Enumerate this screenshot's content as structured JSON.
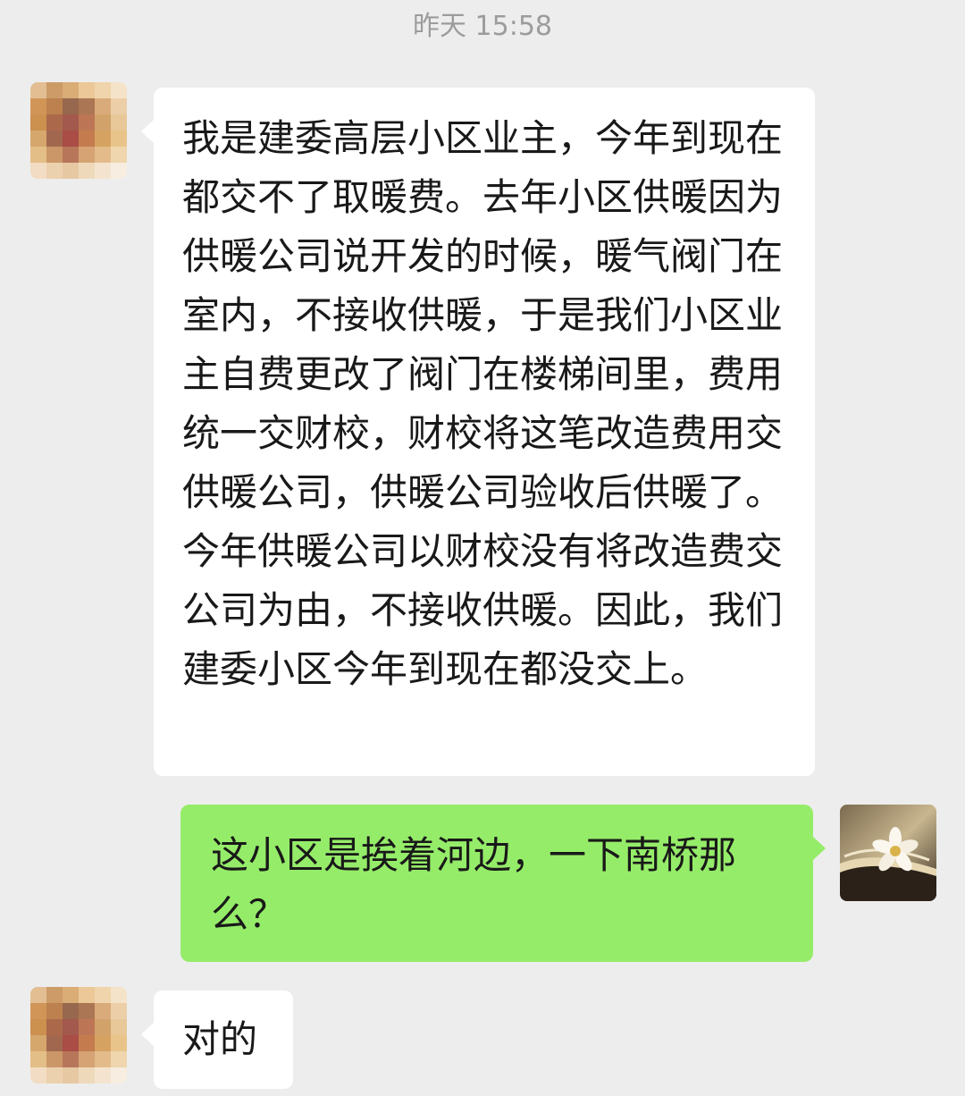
{
  "chat": {
    "timestamp": "昨天 15:58",
    "messages": [
      {
        "side": "left",
        "sender": "other",
        "text": "我是建委高层小区业主，今年到现在都交不了取暖费。去年小区供暖因为供暖公司说开发的时候，暖气阀门在室内，不接收供暖，于是我们小区业主自费更改了阀门在楼梯间里，费用统一交财校，财校将这笔改造费用交供暖公司，供暖公司验收后供暖了。今年供暖公司以财校没有将改造费交公司为由，不接收供暖。因此，我们建委小区今年到现在都没交上。"
      },
      {
        "side": "right",
        "sender": "self",
        "text": "这小区是挨着河边，一下南桥那么？"
      },
      {
        "side": "left",
        "sender": "other",
        "text": "对的"
      }
    ]
  },
  "colors": {
    "background": "#ededed",
    "bubble_incoming": "#ffffff",
    "bubble_outgoing": "#95ec69",
    "timestamp_text": "#9c9c9c",
    "message_text": "#191919"
  },
  "icons": {
    "other_avatar": "pixelated-avatar-icon",
    "self_avatar": "flower-book-avatar-icon"
  }
}
